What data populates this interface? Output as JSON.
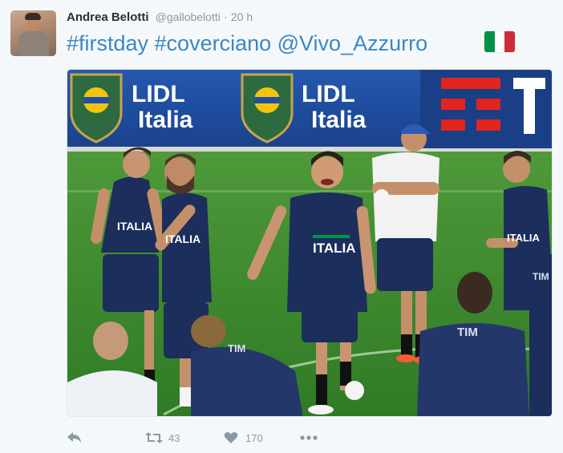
{
  "tweet": {
    "author_name": "Andrea Belotti",
    "handle": "@gallobelotti",
    "separator": "·",
    "time": "20 h",
    "text": "#firstday #coverciano @Vivo_Azzurro",
    "flag": "Italy flag",
    "flag_colors": [
      "#009246",
      "#ffffff",
      "#ce2b37"
    ]
  },
  "media": {
    "banner_texts": [
      "LIDL",
      "Italia",
      "LIDL",
      "Italia"
    ],
    "shirt_texts": [
      "ITALIA",
      "ITALIA",
      "ITALIA",
      "ITALIA"
    ],
    "sponsor_texts": [
      "TIM",
      "TIM",
      "TIM"
    ],
    "colors": {
      "banner": "#1f4fa3",
      "pitch": "#3e8a2e",
      "kit": "#1c2e5c",
      "tim_red": "#e2241f"
    }
  },
  "actions": {
    "reply_icon": "reply-icon",
    "retweet_icon": "retweet-icon",
    "retweet_count": "43",
    "like_icon": "heart-icon",
    "like_count": "170",
    "more_icon": "more-icon"
  }
}
